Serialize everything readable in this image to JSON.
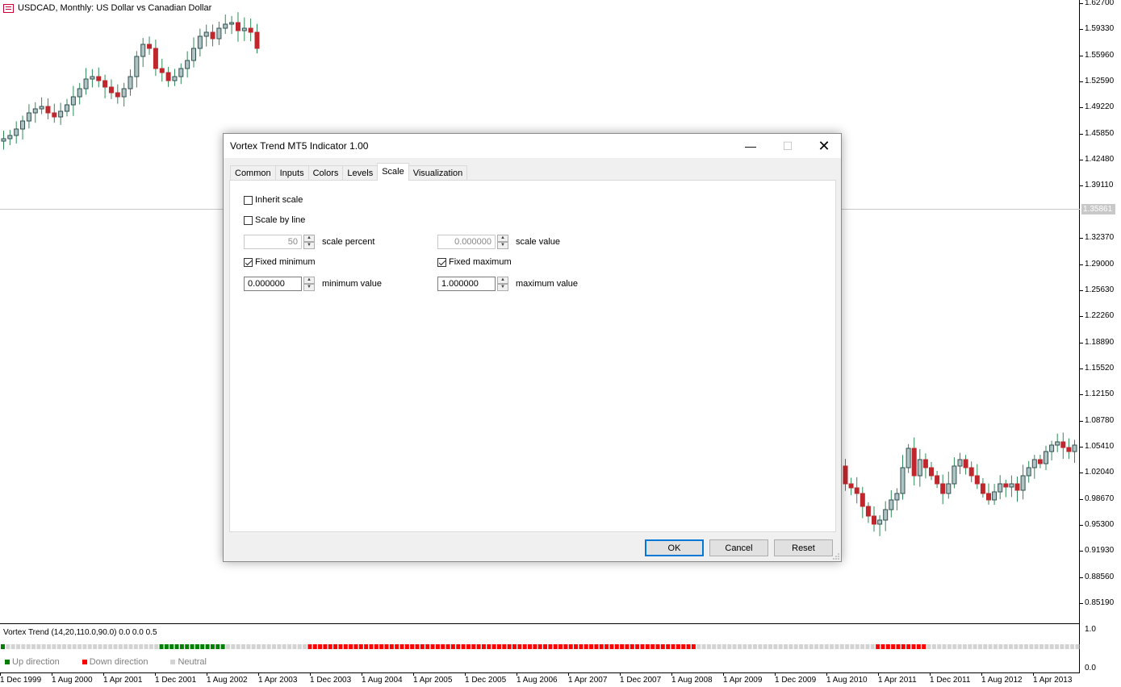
{
  "chart": {
    "title": "USDCAD, Monthly:  US Dollar vs Canadian Dollar",
    "current_price": "1.35861",
    "price_ticks": [
      "1.62700",
      "1.59330",
      "1.55960",
      "1.52590",
      "1.49220",
      "1.45850",
      "1.42480",
      "1.39110",
      "1.32370",
      "1.29000",
      "1.25630",
      "1.22260",
      "1.18890",
      "1.15520",
      "1.12150",
      "1.08780",
      "1.05410",
      "1.02040",
      "0.98670",
      "0.95300",
      "0.91930",
      "0.88560",
      "0.85190"
    ],
    "time_ticks": [
      "1 Dec 1999",
      "1 Aug 2000",
      "1 Apr 2001",
      "1 Dec 2001",
      "1 Aug 2002",
      "1 Apr 2003",
      "1 Dec 2003",
      "1 Aug 2004",
      "1 Apr 2005",
      "1 Dec 2005",
      "1 Aug 2006",
      "1 Apr 2007",
      "1 Dec 2007",
      "1 Aug 2008",
      "1 Apr 2009",
      "1 Dec 2009",
      "1 Aug 2010",
      "1 Apr 2011",
      "1 Dec 2011",
      "1 Aug 2012",
      "1 Apr 2013"
    ],
    "colors": {
      "bull": "#2f4f4f",
      "bull_fill": "#b0c4c4",
      "bear": "#c0272d",
      "wick": "#2e8b57"
    }
  },
  "indicator": {
    "title": "Vortex Trend (14,20,110.0,90.0) 0.0 0.0 0.5",
    "axis_top": "1.0",
    "axis_bottom": "0.0",
    "legend": [
      {
        "label": "Up direction",
        "color": "#008000"
      },
      {
        "label": "Down direction",
        "color": "#ff0000"
      },
      {
        "label": "Neutral",
        "color": "#d3d3d3"
      }
    ]
  },
  "dialog": {
    "title": "Vortex Trend MT5 Indicator 1.00",
    "window_buttons": {
      "minimize": "—",
      "maximize": "☐",
      "close": "✕"
    },
    "tabs": [
      "Common",
      "Inputs",
      "Colors",
      "Levels",
      "Scale",
      "Visualization"
    ],
    "active_tab": "Scale",
    "inherit_scale": {
      "label": "Inherit scale",
      "checked": false
    },
    "scale_by_line": {
      "label": "Scale by line",
      "checked": false
    },
    "scale_percent": {
      "value": "50",
      "label": "scale percent"
    },
    "scale_value": {
      "value": "0.000000",
      "label": "scale value"
    },
    "fixed_minimum": {
      "label": "Fixed minimum",
      "checked": true
    },
    "fixed_maximum": {
      "label": "Fixed maximum",
      "checked": true
    },
    "minimum_value": {
      "value": "0.000000",
      "label": "minimum value"
    },
    "maximum_value": {
      "value": "1.000000",
      "label": "maximum value"
    },
    "buttons": {
      "ok": "OK",
      "cancel": "Cancel",
      "reset": "Reset"
    }
  }
}
